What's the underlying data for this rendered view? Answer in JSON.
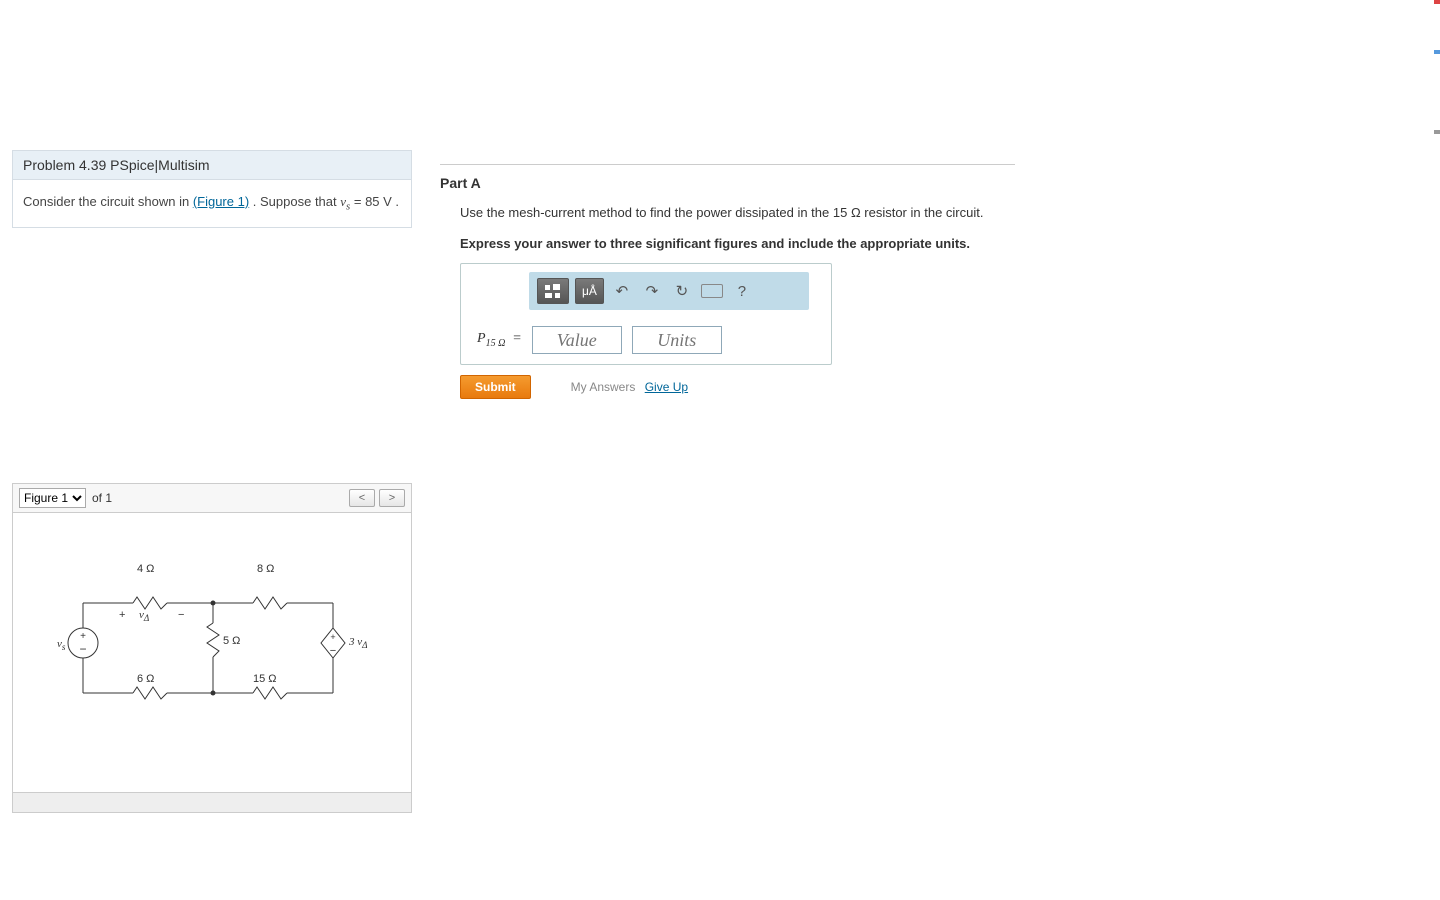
{
  "problem": {
    "title": "Problem 4.39 PSpice|Multisim",
    "prompt_prefix": "Consider the circuit shown in ",
    "figure_link": "(Figure 1)",
    "prompt_suffix": " . Suppose that ",
    "given_var": "v",
    "given_sub": "s",
    "given_eq": " = 85 V ."
  },
  "figure": {
    "select_label": "Figure 1",
    "of_text": "of 1",
    "prev": "<",
    "next": ">",
    "labels": {
      "r4": "4 Ω",
      "r8": "8 Ω",
      "r5": "5 Ω",
      "r6": "6 Ω",
      "r15": "15 Ω",
      "vs": "v",
      "vs_sub": "s",
      "vdelta": "v",
      "vdelta_sub": "Δ",
      "dep": "3 v",
      "dep_sub": "Δ",
      "plus": "+",
      "minus": "−"
    }
  },
  "part": {
    "label": "Part A",
    "question": "Use the mesh-current method to find the power dissipated in the 15 Ω resistor in the circuit.",
    "instruction": "Express your answer to three significant figures and include the appropriate units.",
    "toolbar": {
      "templates": "▯▯",
      "units_btn": "μÅ",
      "undo": "↶",
      "redo": "↷",
      "reset": "↻",
      "help": "?"
    },
    "answer_var": "P",
    "answer_sub": "15 Ω",
    "eq": "=",
    "value_ph": "Value",
    "units_ph": "Units",
    "submit": "Submit",
    "my_answers": "My Answers",
    "give_up": "Give Up"
  }
}
